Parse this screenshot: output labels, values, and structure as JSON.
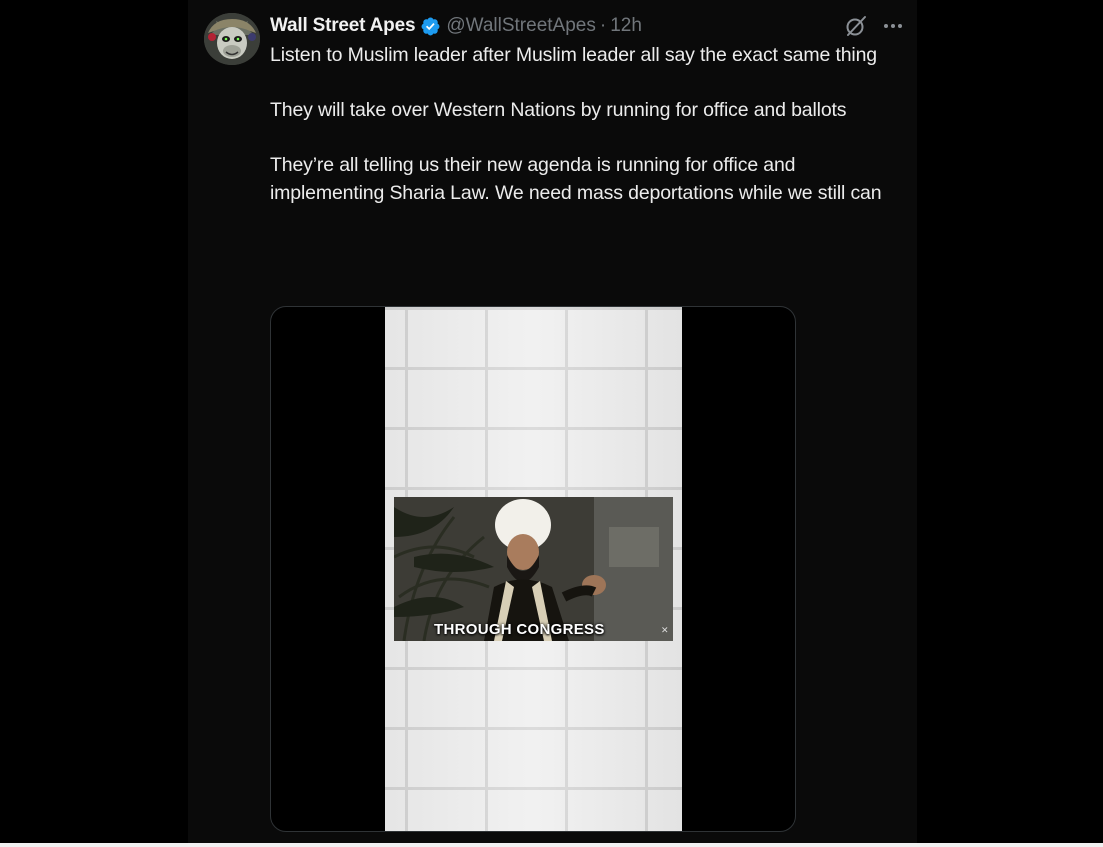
{
  "tweet": {
    "display_name": "Wall Street Apes",
    "handle": "@WallStreetApes",
    "separator": "·",
    "timestamp": "12h",
    "verified": true,
    "paragraphs": [
      "Listen to Muslim leader after Muslim leader all say the exact same thing",
      "They will take over Western Nations by running for office and ballots",
      "They’re all telling us their new agenda is running for office and implementing Sharia Law. We need mass deportations while we still can"
    ],
    "media": {
      "type": "video",
      "caption": "THROUGH CONGRESS"
    }
  },
  "icons": {
    "verified": "verified-badge-icon",
    "grok": "grok-icon",
    "more": "more-options-icon",
    "avatar": "ape-avatar"
  },
  "colors": {
    "background": "#000000",
    "text": "#e7e9ea",
    "muted": "#71767b",
    "verified_blue": "#1d9bf0"
  }
}
